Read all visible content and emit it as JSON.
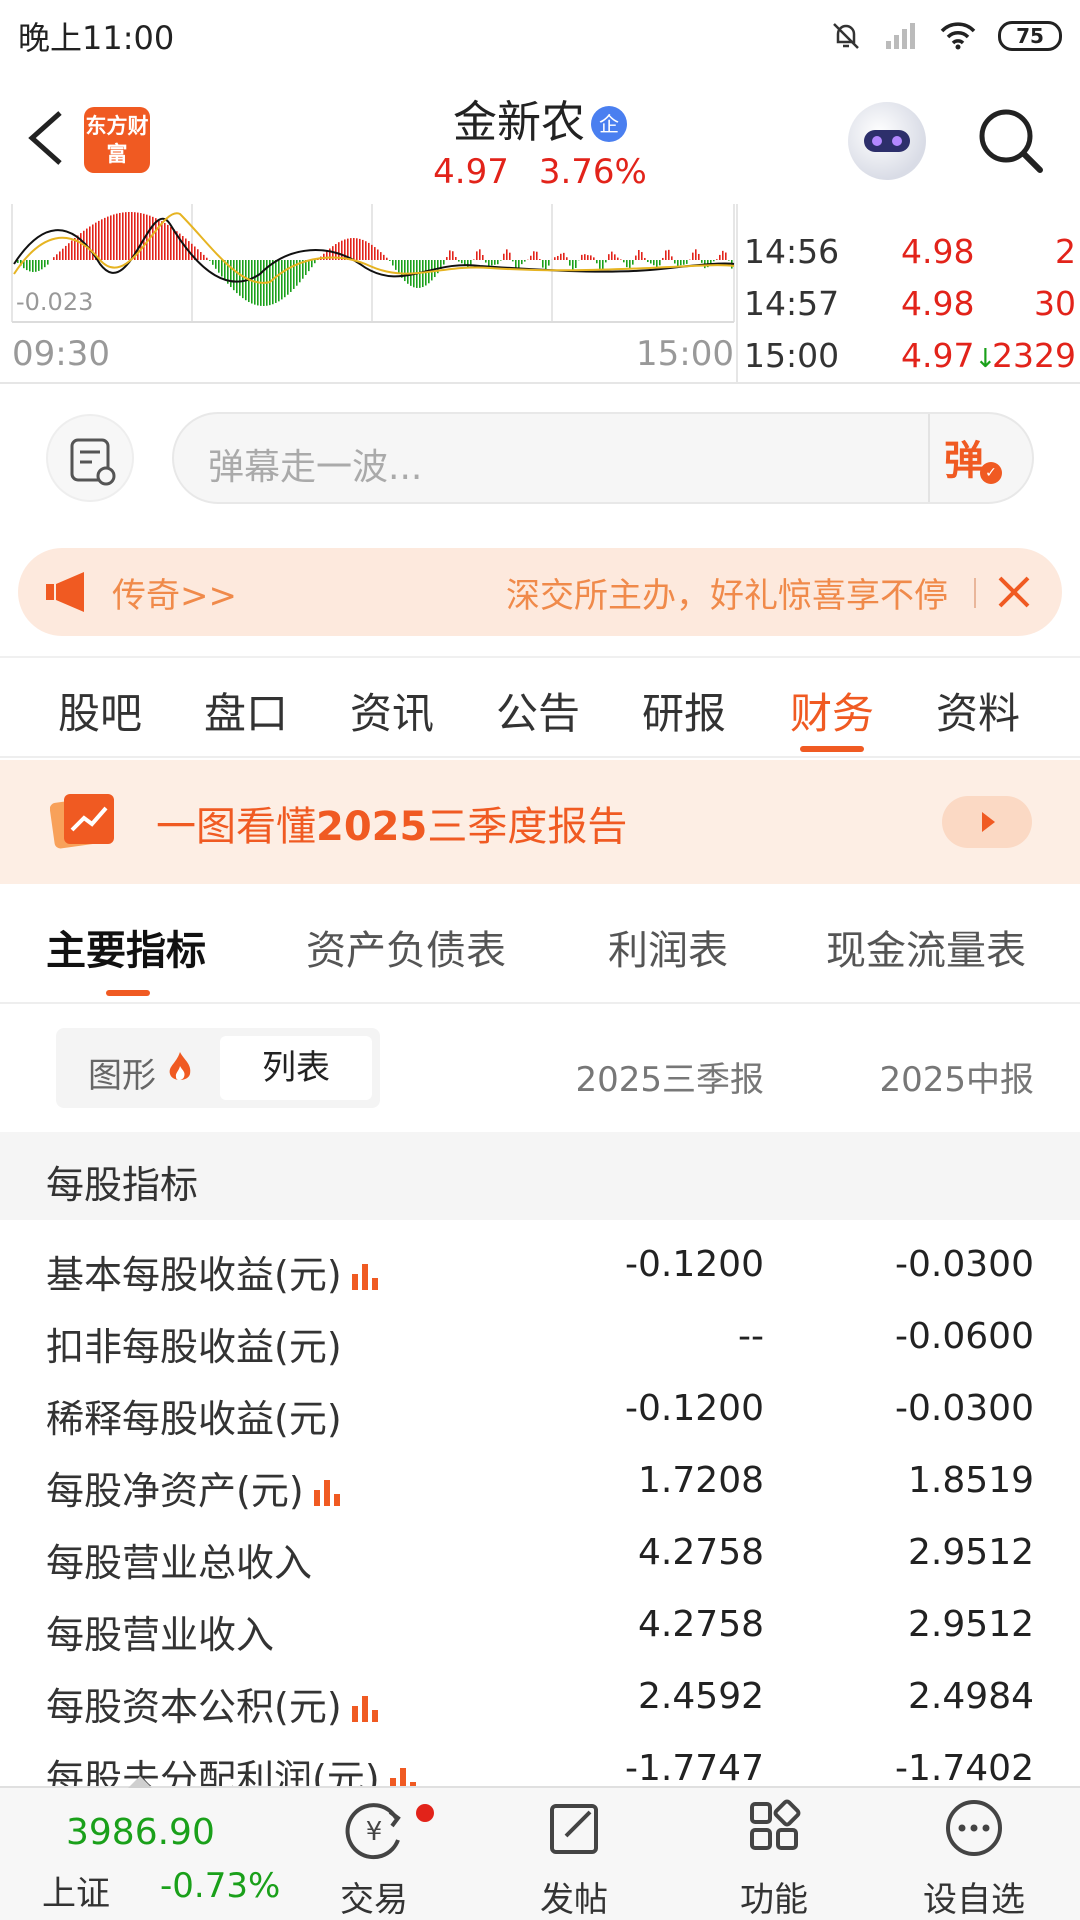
{
  "status": {
    "time": "晚上11:00",
    "battery": "75"
  },
  "header": {
    "app_logo": "东方财富",
    "stock_name": "金新农",
    "badge": "企",
    "price": "4.97",
    "change_pct": "3.76%"
  },
  "chart": {
    "neg_label": "-0.023",
    "x_start": "09:30",
    "x_end": "15:00"
  },
  "ticks": [
    {
      "time": "14:56",
      "price": "4.98",
      "vol": "2",
      "dir": ""
    },
    {
      "time": "14:57",
      "price": "4.98",
      "vol": "30",
      "dir": ""
    },
    {
      "time": "15:00",
      "price": "4.97",
      "vol": "2329",
      "dir": "↓"
    }
  ],
  "danmaku": {
    "placeholder": "弹幕走一波...",
    "send_label": "弹"
  },
  "notice": {
    "tag": "传奇>>",
    "text": "深交所主办，好礼惊喜享不停"
  },
  "main_tabs": [
    "股吧",
    "盘口",
    "资讯",
    "公告",
    "研报",
    "财务",
    "资料"
  ],
  "main_tab_active": "财务",
  "report_banner": {
    "prefix": "一图看懂",
    "year": "2025",
    "suffix": "三季度报告"
  },
  "sub_tabs": [
    "主要指标",
    "资产负债表",
    "利润表",
    "现金流量表"
  ],
  "view_toggle": {
    "graph": "图形",
    "list": "列表"
  },
  "columns": [
    "2025三季报",
    "2025中报"
  ],
  "section_title": "每股指标",
  "rows": [
    {
      "label": "基本每股收益(元)",
      "has_chart": true,
      "v1": "-0.1200",
      "v2": "-0.0300"
    },
    {
      "label": "扣非每股收益(元)",
      "has_chart": false,
      "v1": "--",
      "v2": "-0.0600"
    },
    {
      "label": "稀释每股收益(元)",
      "has_chart": false,
      "v1": "-0.1200",
      "v2": "-0.0300"
    },
    {
      "label": "每股净资产(元)",
      "has_chart": true,
      "v1": "1.7208",
      "v2": "1.8519"
    },
    {
      "label": "每股营业总收入",
      "has_chart": false,
      "v1": "4.2758",
      "v2": "2.9512"
    },
    {
      "label": "每股营业收入",
      "has_chart": false,
      "v1": "4.2758",
      "v2": "2.9512"
    },
    {
      "label": "每股资本公积(元)",
      "has_chart": true,
      "v1": "2.4592",
      "v2": "2.4984"
    },
    {
      "label": "每股未分配利润(元)",
      "has_chart": true,
      "v1": "-1.7747",
      "v2": "-1.7402"
    }
  ],
  "bottom_nav": {
    "index_value": "3986.90",
    "index_name": "上证",
    "index_change": "-0.73%",
    "items": [
      "交易",
      "发帖",
      "功能",
      "设自选"
    ]
  },
  "colors": {
    "accent": "#f05a22",
    "up": "#e2231a",
    "down": "#1aa01a"
  }
}
